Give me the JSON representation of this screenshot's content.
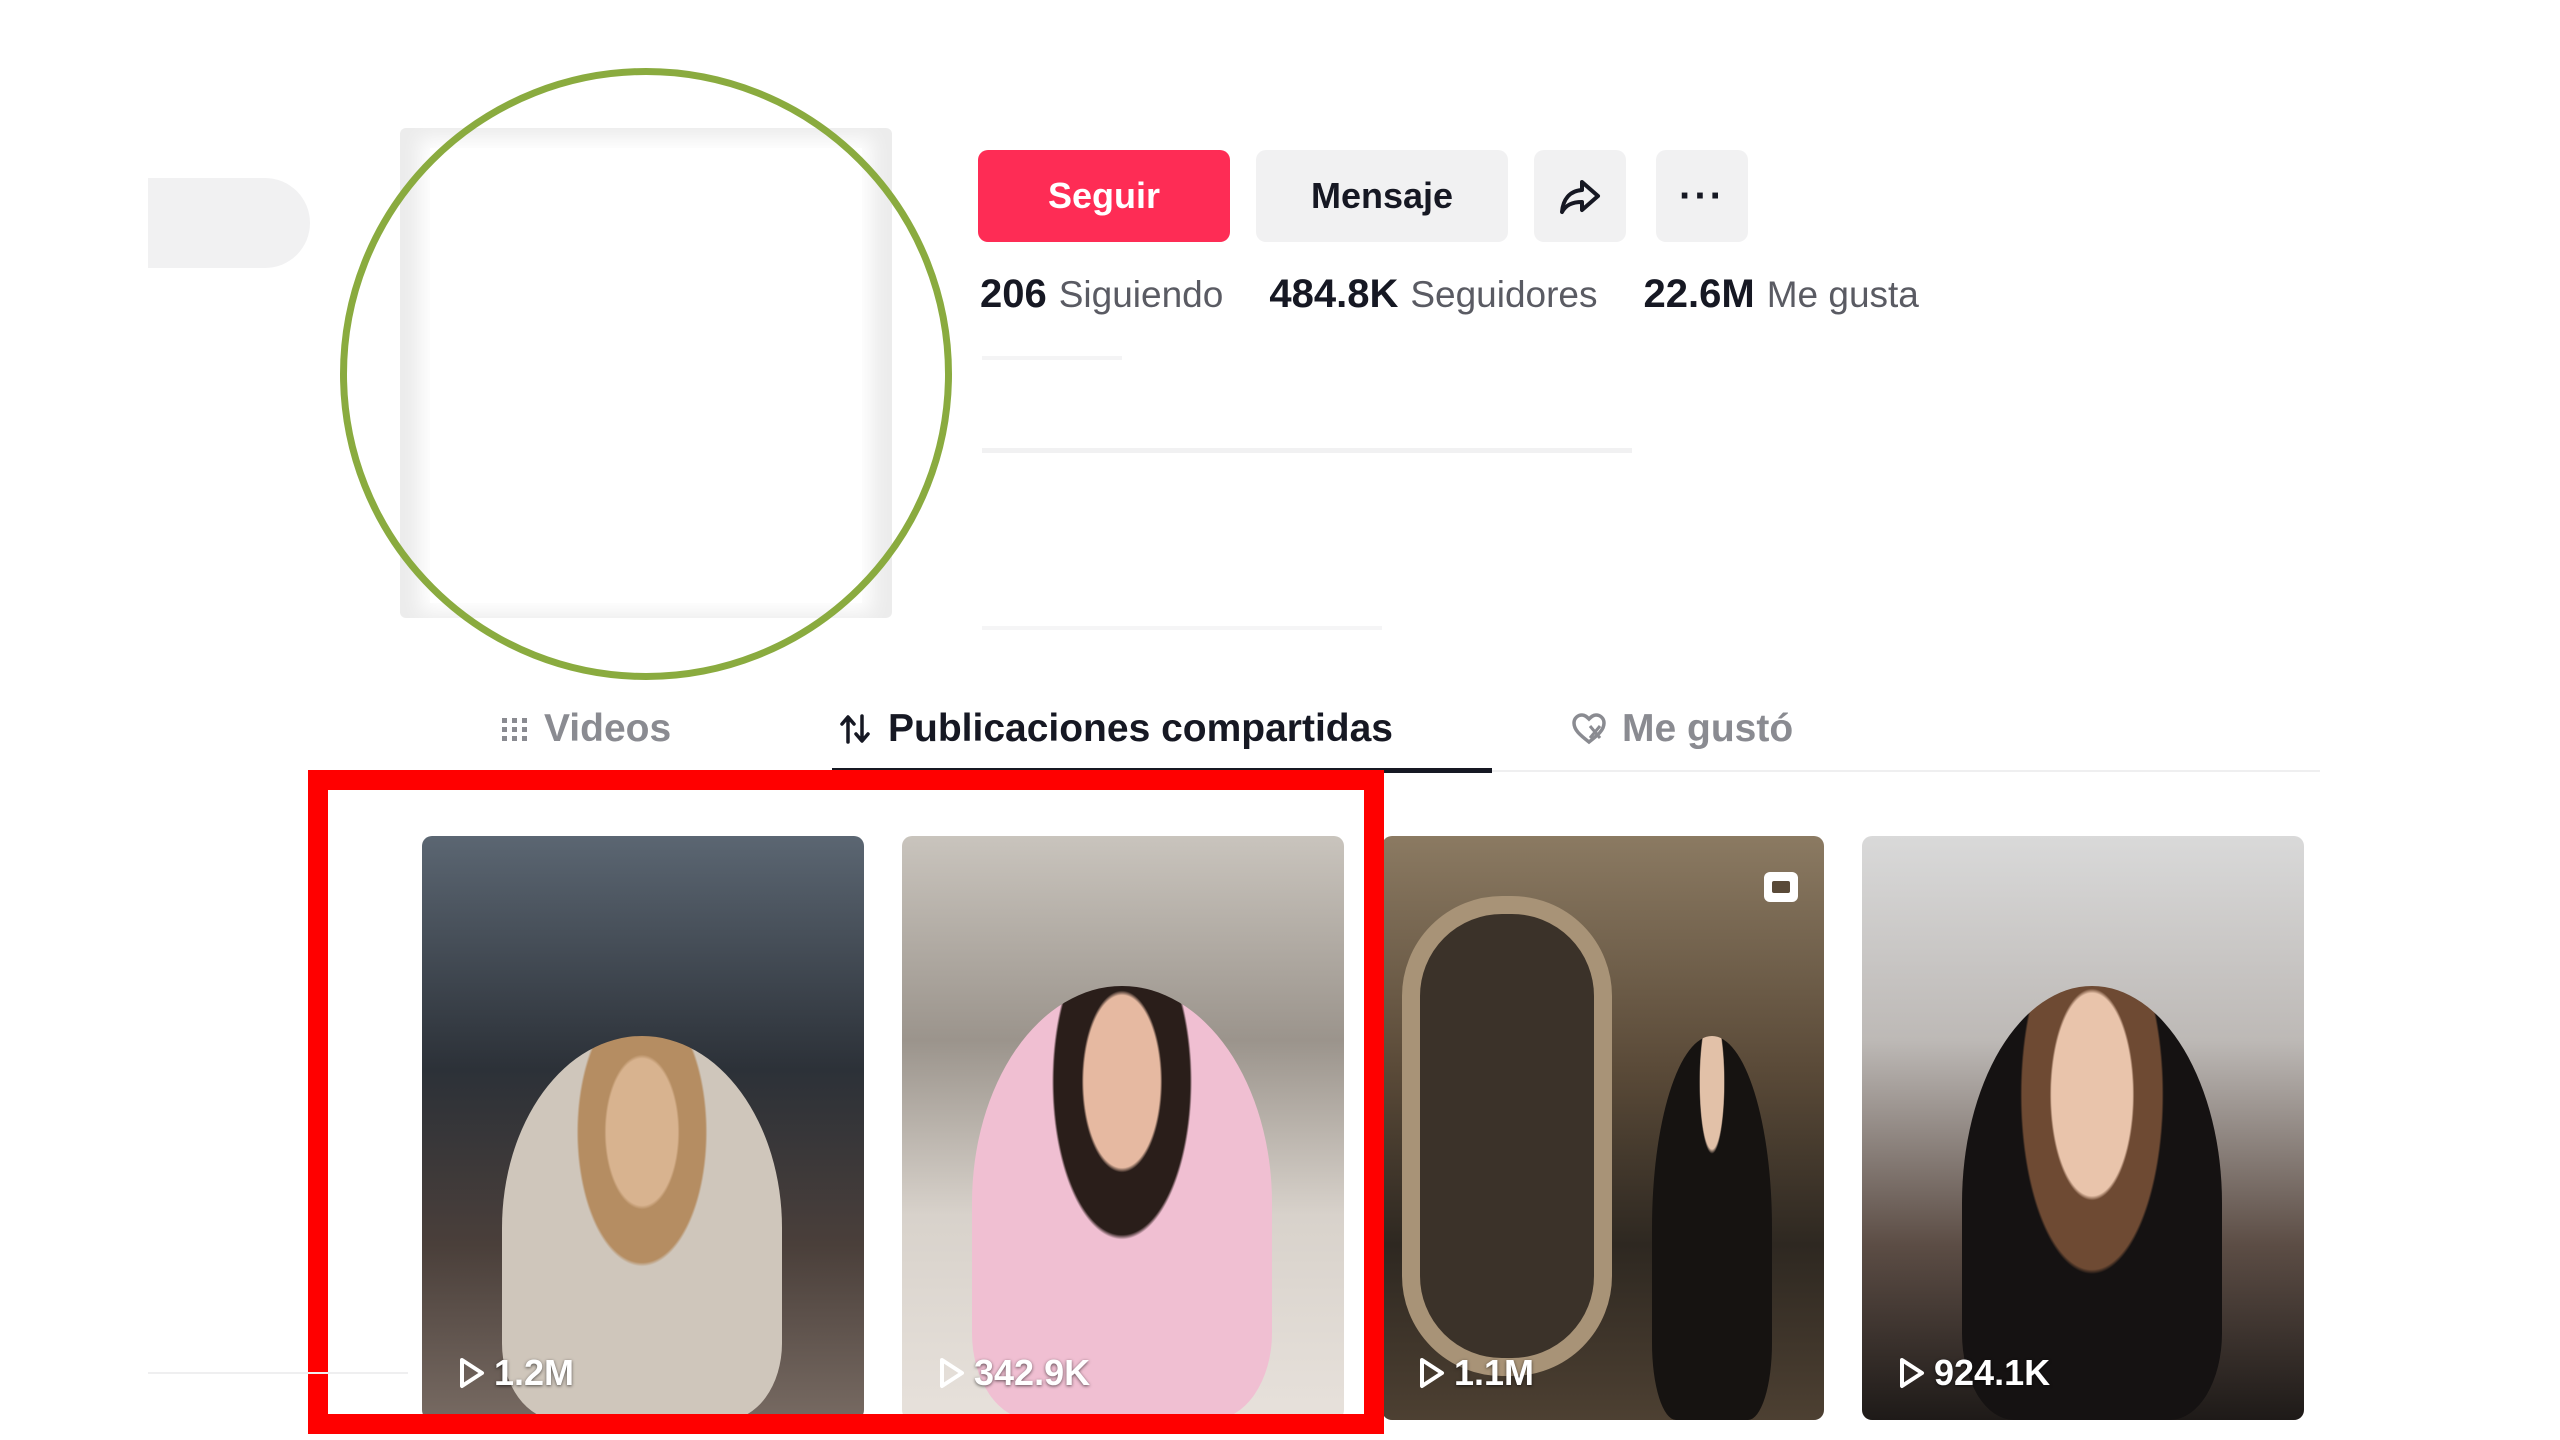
{
  "profile": {
    "buttons": {
      "follow": "Seguir",
      "message": "Mensaje",
      "share_icon": "share-arrow-icon",
      "more": "···"
    },
    "stats": [
      {
        "value": "206",
        "label": "Siguiendo"
      },
      {
        "value": "484.8K",
        "label": "Seguidores"
      },
      {
        "value": "22.6M",
        "label": "Me gusta"
      }
    ]
  },
  "tabs": [
    {
      "label": "Videos",
      "icon": "grid-icon",
      "active": false
    },
    {
      "label": "Publicaciones compartidas",
      "icon": "repost-icon",
      "active": true
    },
    {
      "label": "Me gustó",
      "icon": "heart-hidden-icon",
      "active": false
    }
  ],
  "videos": [
    {
      "views": "1.2M"
    },
    {
      "views": "342.9K"
    },
    {
      "views": "1.1M",
      "is_photo": true
    },
    {
      "views": "924.1K"
    }
  ],
  "colors": {
    "follow_button": "#fe2c55",
    "button_bg": "#f1f1f2",
    "avatar_ring": "#8aab3f",
    "highlight_box": "#ff0000"
  }
}
